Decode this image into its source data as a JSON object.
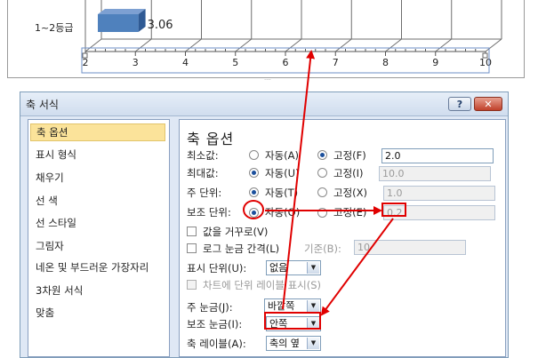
{
  "chart": {
    "category_label": "1~2등급",
    "bar_value_label": "3.06",
    "x_ticks": [
      "2",
      "3",
      "4",
      "5",
      "6",
      "7",
      "8",
      "9",
      "10"
    ]
  },
  "chart_data": {
    "type": "bar",
    "orientation": "horizontal",
    "categories": [
      "1~2등급"
    ],
    "values": [
      3.06
    ],
    "xlim": [
      2,
      10
    ],
    "x_ticks": [
      2,
      3,
      4,
      5,
      6,
      7,
      8,
      9,
      10
    ],
    "data_labels": [
      "3.06"
    ],
    "grid": true,
    "bar_color": "#4f81bd"
  },
  "dialog": {
    "title": "축 서식",
    "help_label": "?",
    "close_label": "✕",
    "sidebar": {
      "items": [
        {
          "label": "축 옵션",
          "selected": true
        },
        {
          "label": "표시 형식"
        },
        {
          "label": "채우기"
        },
        {
          "label": "선 색"
        },
        {
          "label": "선 스타일"
        },
        {
          "label": "그림자"
        },
        {
          "label": "네온 및 부드러운 가장자리"
        },
        {
          "label": "3차원 서식"
        },
        {
          "label": "맞춤"
        }
      ]
    },
    "panel": {
      "title": "축 옵션",
      "min": {
        "label": "최소값:",
        "auto": "자동(A)",
        "fixed": "고정(F)",
        "value": "2.0",
        "selected": "fixed"
      },
      "max": {
        "label": "최대값:",
        "auto": "자동(U)",
        "fixed": "고정(I)",
        "value": "10.0",
        "selected": "auto"
      },
      "major_unit": {
        "label": "주 단위:",
        "auto": "자동(T)",
        "fixed": "고정(X)",
        "value": "1.0",
        "selected": "auto"
      },
      "minor_unit": {
        "label": "보조 단위:",
        "auto": "자동(O)",
        "fixed": "고정(E)",
        "value": "0.2",
        "selected": "auto"
      },
      "reverse": {
        "label": "값을 거꾸로(V)",
        "checked": false
      },
      "log": {
        "label": "로그 눈금 간격(L)",
        "base_label": "기준(B):",
        "base_value": "10",
        "checked": false
      },
      "display_units": {
        "label": "표시 단위(U):",
        "value": "없음"
      },
      "show_units": {
        "label": "차트에 단위 레이블 표시(S)"
      },
      "major_tick": {
        "label": "주 눈금(J):",
        "value": "바깥쪽"
      },
      "minor_tick": {
        "label": "보조 눈금(I):",
        "value": "안쪽"
      },
      "axis_labels": {
        "label": "축 레이블(A):",
        "value": "축의 옆"
      }
    }
  },
  "annotation": {
    "color": "#e00000"
  }
}
